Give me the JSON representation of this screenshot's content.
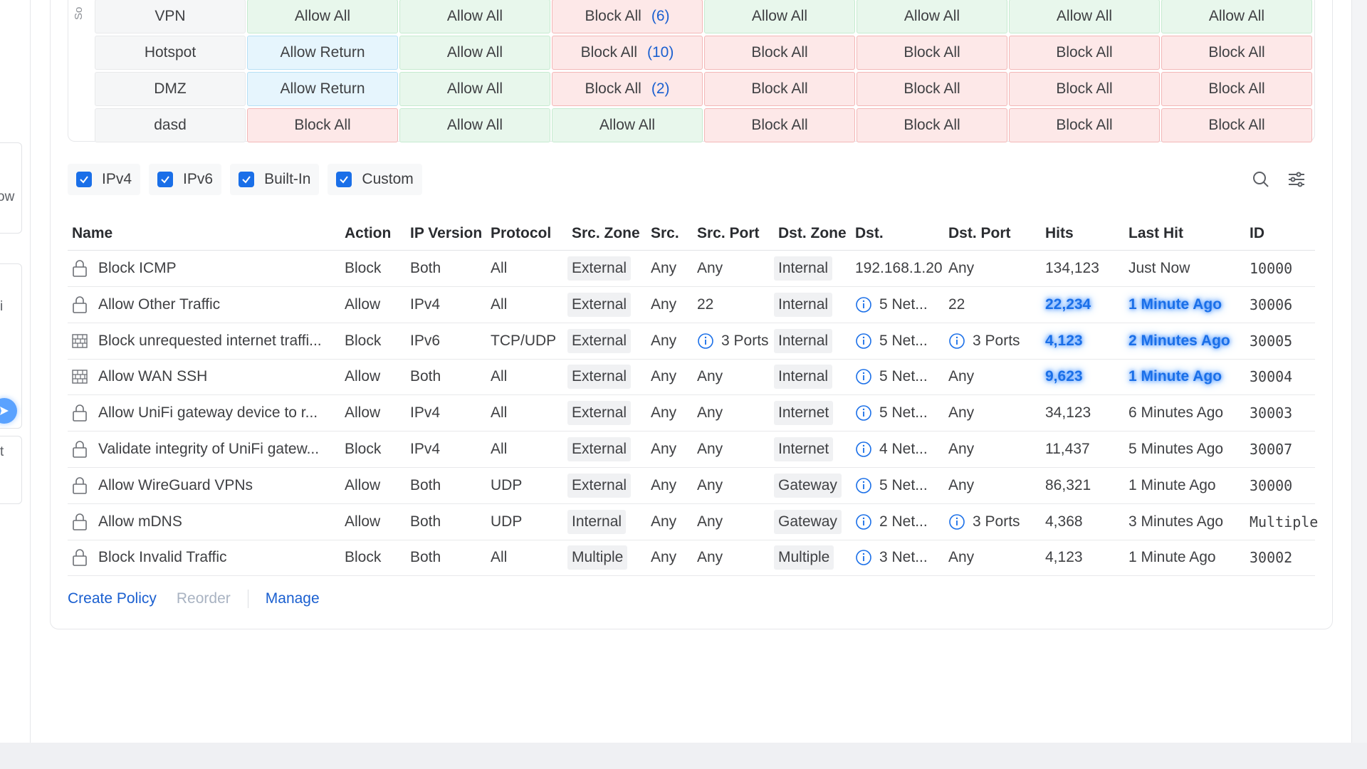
{
  "left_fragments": {
    "a": "ow",
    "b": "i",
    "c": "t"
  },
  "matrix": {
    "side_label": "So",
    "rows": [
      {
        "zone": "VPN",
        "cells": [
          {
            "label": "Allow All",
            "state": "allow",
            "count": ""
          },
          {
            "label": "Allow All",
            "state": "allow",
            "count": ""
          },
          {
            "label": "Block All",
            "state": "block",
            "count": "(6)"
          },
          {
            "label": "Allow All",
            "state": "allow",
            "count": ""
          },
          {
            "label": "Allow All",
            "state": "allow",
            "count": ""
          },
          {
            "label": "Allow All",
            "state": "allow",
            "count": ""
          },
          {
            "label": "Allow All",
            "state": "allow",
            "count": ""
          }
        ]
      },
      {
        "zone": "Hotspot",
        "cells": [
          {
            "label": "Allow Return",
            "state": "return",
            "count": ""
          },
          {
            "label": "Allow All",
            "state": "allow",
            "count": ""
          },
          {
            "label": "Block All",
            "state": "block",
            "count": "(10)"
          },
          {
            "label": "Block All",
            "state": "block",
            "count": ""
          },
          {
            "label": "Block All",
            "state": "block",
            "count": ""
          },
          {
            "label": "Block All",
            "state": "block",
            "count": ""
          },
          {
            "label": "Block All",
            "state": "block",
            "count": ""
          }
        ]
      },
      {
        "zone": "DMZ",
        "cells": [
          {
            "label": "Allow Return",
            "state": "return",
            "count": ""
          },
          {
            "label": "Allow All",
            "state": "allow",
            "count": ""
          },
          {
            "label": "Block All",
            "state": "block",
            "count": "(2)"
          },
          {
            "label": "Block All",
            "state": "block",
            "count": ""
          },
          {
            "label": "Block All",
            "state": "block",
            "count": ""
          },
          {
            "label": "Block All",
            "state": "block",
            "count": ""
          },
          {
            "label": "Block All",
            "state": "block",
            "count": ""
          }
        ]
      },
      {
        "zone": "dasd",
        "cells": [
          {
            "label": "Block All",
            "state": "block",
            "count": ""
          },
          {
            "label": "Allow All",
            "state": "allow",
            "count": ""
          },
          {
            "label": "Allow All",
            "state": "allow",
            "count": ""
          },
          {
            "label": "Block All",
            "state": "block",
            "count": ""
          },
          {
            "label": "Block All",
            "state": "block",
            "count": ""
          },
          {
            "label": "Block All",
            "state": "block",
            "count": ""
          },
          {
            "label": "Block All",
            "state": "block",
            "count": ""
          }
        ]
      }
    ]
  },
  "filters": [
    {
      "label": "IPv4",
      "checked": true
    },
    {
      "label": "IPv6",
      "checked": true
    },
    {
      "label": "Built-In",
      "checked": true
    },
    {
      "label": "Custom",
      "checked": true
    }
  ],
  "table": {
    "headers": {
      "name": "Name",
      "action": "Action",
      "ip_version": "IP Version",
      "protocol": "Protocol",
      "src_zone": "Src. Zone",
      "src": "Src.",
      "src_port": "Src. Port",
      "dst_zone": "Dst. Zone",
      "dst": "Dst.",
      "dst_port": "Dst. Port",
      "hits": "Hits",
      "last_hit": "Last Hit",
      "id": "ID"
    },
    "rows": [
      {
        "icon": "lock-icon",
        "name": "Block ICMP",
        "action": "Block",
        "ip_version": "Both",
        "protocol": "All",
        "src_zone": "External",
        "src": "Any",
        "src_port": "Any",
        "src_port_info": false,
        "dst_zone": "Internal",
        "dst": "192.168.1.20",
        "dst_info": false,
        "dst_port": "Any",
        "dst_port_info": false,
        "hits": "134,123",
        "last_hit": "Just Now",
        "id": "10000",
        "highlight": false
      },
      {
        "icon": "lock-icon",
        "name": "Allow Other Traffic",
        "action": "Allow",
        "ip_version": "IPv4",
        "protocol": "All",
        "src_zone": "External",
        "src": "Any",
        "src_port": "22",
        "src_port_info": false,
        "dst_zone": "Internal",
        "dst": "5 Net...",
        "dst_info": true,
        "dst_port": "22",
        "dst_port_info": false,
        "hits": "22,234",
        "last_hit": "1 Minute Ago",
        "id": "30006",
        "highlight": true
      },
      {
        "icon": "firewall-icon",
        "name": "Block unrequested internet traffi...",
        "action": "Block",
        "ip_version": "IPv6",
        "protocol": "TCP/UDP",
        "src_zone": "External",
        "src": "Any",
        "src_port": "3 Ports",
        "src_port_info": true,
        "dst_zone": "Internal",
        "dst": "5 Net...",
        "dst_info": true,
        "dst_port": "3 Ports",
        "dst_port_info": true,
        "hits": "4,123",
        "last_hit": "2 Minutes Ago",
        "id": "30005",
        "highlight": true
      },
      {
        "icon": "firewall-icon",
        "name": "Allow WAN SSH",
        "action": "Allow",
        "ip_version": "Both",
        "protocol": "All",
        "src_zone": "External",
        "src": "Any",
        "src_port": "Any",
        "src_port_info": false,
        "dst_zone": "Internal",
        "dst": "5 Net...",
        "dst_info": true,
        "dst_port": "Any",
        "dst_port_info": false,
        "hits": "9,623",
        "last_hit": "1 Minute Ago",
        "id": "30004",
        "highlight": true
      },
      {
        "icon": "lock-icon",
        "name": "Allow UniFi gateway device to r...",
        "action": "Allow",
        "ip_version": "IPv4",
        "protocol": "All",
        "src_zone": "External",
        "src": "Any",
        "src_port": "Any",
        "src_port_info": false,
        "dst_zone": "Internet",
        "dst": "5 Net...",
        "dst_info": true,
        "dst_port": "Any",
        "dst_port_info": false,
        "hits": "34,123",
        "last_hit": "6 Minutes Ago",
        "id": "30003",
        "highlight": false
      },
      {
        "icon": "lock-icon",
        "name": "Validate integrity of UniFi gatew...",
        "action": "Block",
        "ip_version": "IPv4",
        "protocol": "All",
        "src_zone": "External",
        "src": "Any",
        "src_port": "Any",
        "src_port_info": false,
        "dst_zone": "Internet",
        "dst": "4 Net...",
        "dst_info": true,
        "dst_port": "Any",
        "dst_port_info": false,
        "hits": "11,437",
        "last_hit": "5 Minutes Ago",
        "id": "30007",
        "highlight": false
      },
      {
        "icon": "lock-icon",
        "name": "Allow WireGuard VPNs",
        "action": "Allow",
        "ip_version": "Both",
        "protocol": "UDP",
        "src_zone": "External",
        "src": "Any",
        "src_port": "Any",
        "src_port_info": false,
        "dst_zone": "Gateway",
        "dst": "5 Net...",
        "dst_info": true,
        "dst_port": "Any",
        "dst_port_info": false,
        "hits": "86,321",
        "last_hit": "1 Minute Ago",
        "id": "30000",
        "highlight": false
      },
      {
        "icon": "lock-icon",
        "name": "Allow mDNS",
        "action": "Allow",
        "ip_version": "Both",
        "protocol": "UDP",
        "src_zone": "Internal",
        "src": "Any",
        "src_port": "Any",
        "src_port_info": false,
        "dst_zone": "Gateway",
        "dst": "2 Net...",
        "dst_info": true,
        "dst_port": "3 Ports",
        "dst_port_info": true,
        "hits": "4,368",
        "last_hit": "3 Minutes Ago",
        "id": "Multiple",
        "highlight": false
      },
      {
        "icon": "lock-icon",
        "name": "Block Invalid Traffic",
        "action": "Block",
        "ip_version": "Both",
        "protocol": "All",
        "src_zone": "Multiple",
        "src": "Any",
        "src_port": "Any",
        "src_port_info": false,
        "dst_zone": "Multiple",
        "dst": "3 Net...",
        "dst_info": true,
        "dst_port": "Any",
        "dst_port_info": false,
        "hits": "4,123",
        "last_hit": "1 Minute Ago",
        "id": "30002",
        "highlight": false
      }
    ]
  },
  "footer": {
    "create": "Create Policy",
    "reorder": "Reorder",
    "manage": "Manage"
  },
  "toolbar": {
    "search_icon": "search-icon",
    "filter_icon": "sliders-icon"
  },
  "colors": {
    "accent": "#1a6fe8",
    "allow_bg": "#e8f7ec",
    "block_bg": "#fde8e8",
    "return_bg": "#e6f5fd"
  }
}
